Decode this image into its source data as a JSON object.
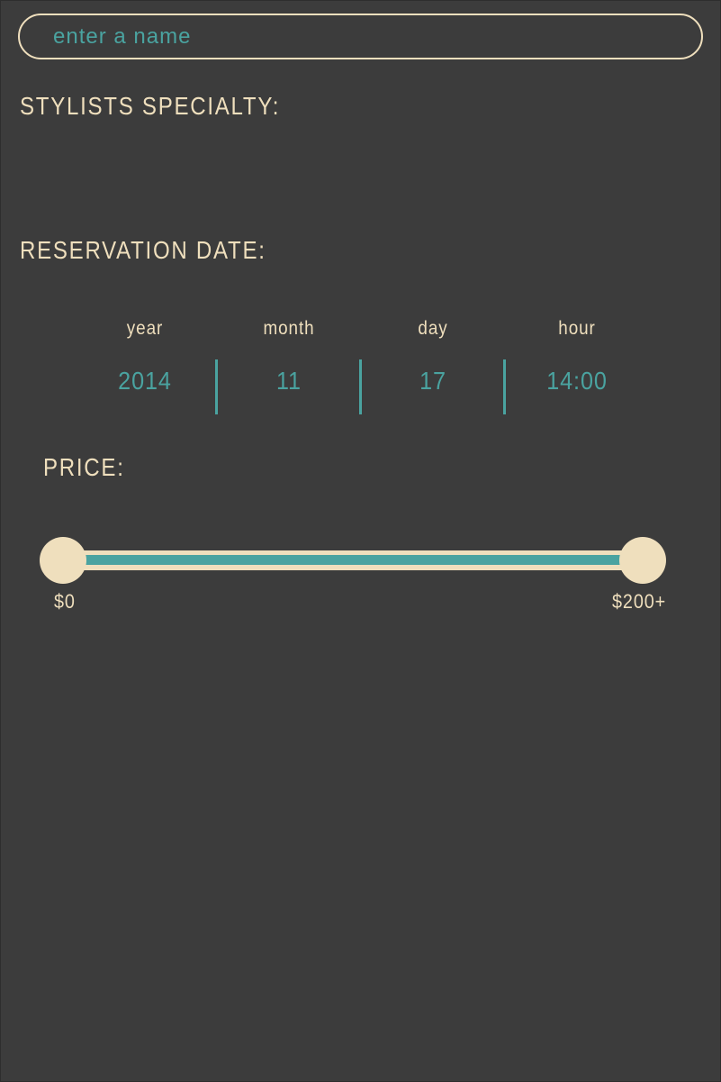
{
  "name_field": {
    "placeholder": "enter a name",
    "value": ""
  },
  "sections": {
    "specialty_label": "STYLISTS SPECIALTY:",
    "date_label": "RESERVATION DATE:",
    "price_label": "PRICE:"
  },
  "reservation_date": {
    "columns": [
      {
        "header": "year",
        "value": "2014"
      },
      {
        "header": "month",
        "value": "11"
      },
      {
        "header": "day",
        "value": "17"
      },
      {
        "header": "hour",
        "value": "14:00"
      }
    ]
  },
  "price": {
    "min_label": "$0",
    "max_label": "$200+",
    "range_low_fraction": 0,
    "range_high_fraction": 1
  },
  "colors": {
    "background": "#3c3c3c",
    "cream": "#efdfbd",
    "teal": "#4aa3a0"
  }
}
